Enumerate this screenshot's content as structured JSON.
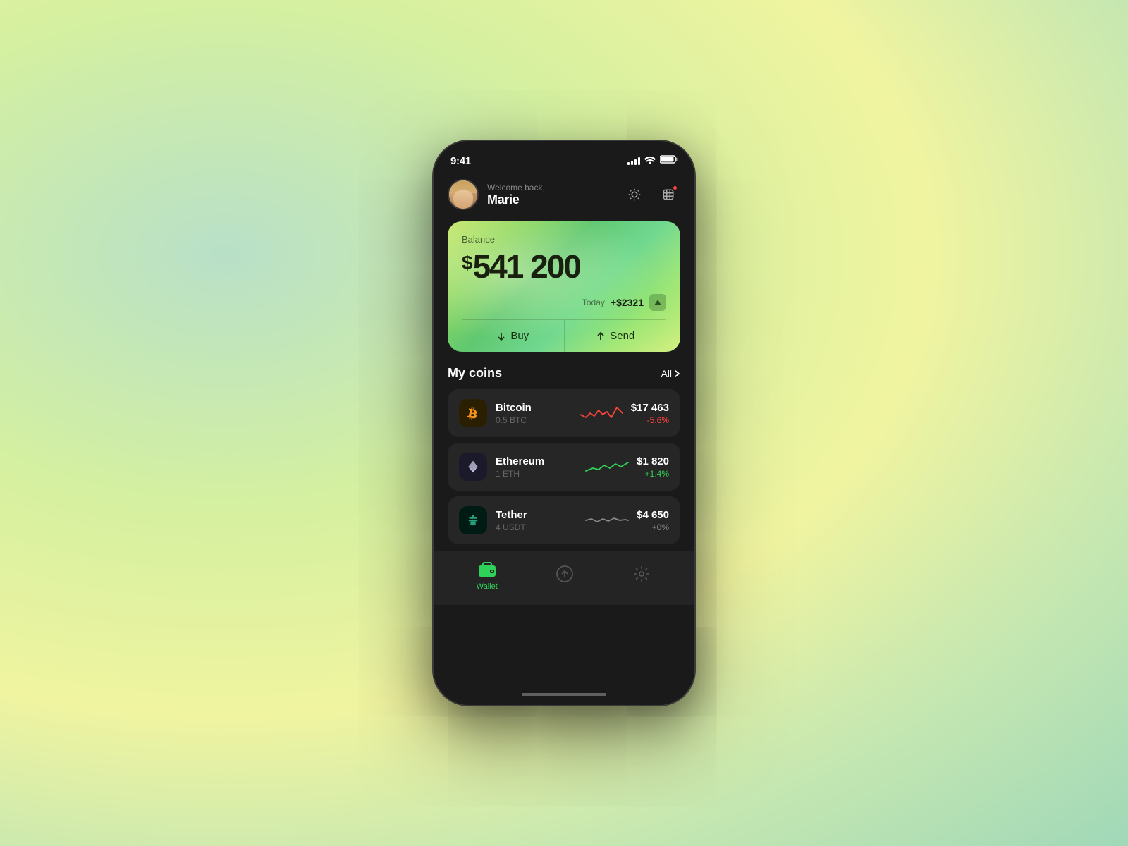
{
  "background": {
    "gradient": "radial-gradient green-yellow"
  },
  "statusBar": {
    "time": "9:41",
    "signal": "strong",
    "wifi": true,
    "battery": "full"
  },
  "header": {
    "greeting": "Welcome back,",
    "name": "Marie",
    "theme_btn_label": "theme",
    "notif_btn_label": "notifications"
  },
  "balanceCard": {
    "label": "Balance",
    "amount": "541 200",
    "dollar_sign": "$",
    "today_label": "Today",
    "today_amount": "+$2321",
    "buy_label": "Buy",
    "send_label": "Send"
  },
  "myCoins": {
    "title": "My coins",
    "all_label": "All",
    "coins": [
      {
        "name": "Bitcoin",
        "ticker": "0.5 BTC",
        "symbol": "BTC",
        "value": "$17 463",
        "change": "-5.6%",
        "change_type": "negative",
        "icon_type": "btc"
      },
      {
        "name": "Ethereum",
        "ticker": "1 ETH",
        "symbol": "ETH",
        "value": "$1 820",
        "change": "+1.4%",
        "change_type": "positive",
        "icon_type": "eth"
      },
      {
        "name": "Tether",
        "ticker": "4 USDT",
        "symbol": "USDT",
        "value": "$4 650",
        "change": "+0%",
        "change_type": "neutral",
        "icon_type": "usdt"
      }
    ]
  },
  "bottomNav": {
    "items": [
      {
        "label": "Wallet",
        "icon": "wallet-icon",
        "active": true
      },
      {
        "label": "",
        "icon": "send-icon",
        "active": false
      },
      {
        "label": "",
        "icon": "settings-icon",
        "active": false
      }
    ]
  }
}
